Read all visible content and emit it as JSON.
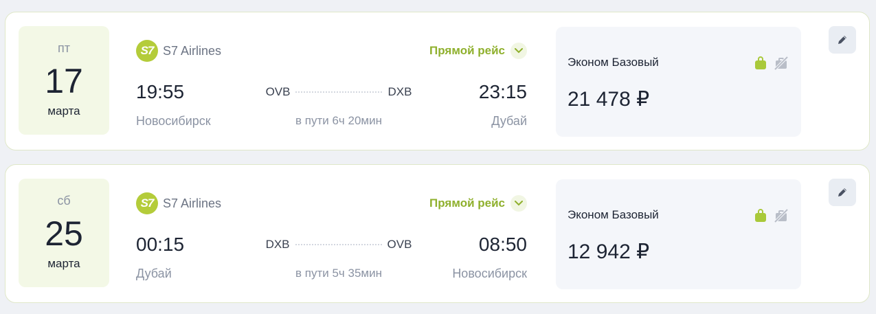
{
  "colors": {
    "accent_green": "#8fb02d",
    "logo_green": "#b4cc3a",
    "date_bg": "#f3f8e6",
    "fare_bg": "#f4f6fa"
  },
  "flights": [
    {
      "date": {
        "dow": "пт",
        "day": "17",
        "month": "марта"
      },
      "airline": {
        "logo_text": "S7",
        "name": "S7 Airlines"
      },
      "direct_label": "Прямой рейс",
      "departure": {
        "time": "19:55",
        "city": "Новосибирск",
        "iata": "OVB"
      },
      "arrival": {
        "time": "23:15",
        "city": "Дубай",
        "iata": "DXB"
      },
      "duration": "в пути 6ч 20мин",
      "fare": {
        "name": "Эконом Базовый",
        "price": "21 478 ₽"
      },
      "icons": [
        "chevron-down-icon",
        "hand-luggage-icon",
        "no-baggage-icon",
        "pencil-icon"
      ]
    },
    {
      "date": {
        "dow": "сб",
        "day": "25",
        "month": "марта"
      },
      "airline": {
        "logo_text": "S7",
        "name": "S7 Airlines"
      },
      "direct_label": "Прямой рейс",
      "departure": {
        "time": "00:15",
        "city": "Дубай",
        "iata": "DXB"
      },
      "arrival": {
        "time": "08:50",
        "city": "Новосибирск",
        "iata": "OVB"
      },
      "duration": "в пути 5ч 35мин",
      "fare": {
        "name": "Эконом Базовый",
        "price": "12 942 ₽"
      },
      "icons": [
        "chevron-down-icon",
        "hand-luggage-icon",
        "no-baggage-icon",
        "pencil-icon"
      ]
    }
  ]
}
